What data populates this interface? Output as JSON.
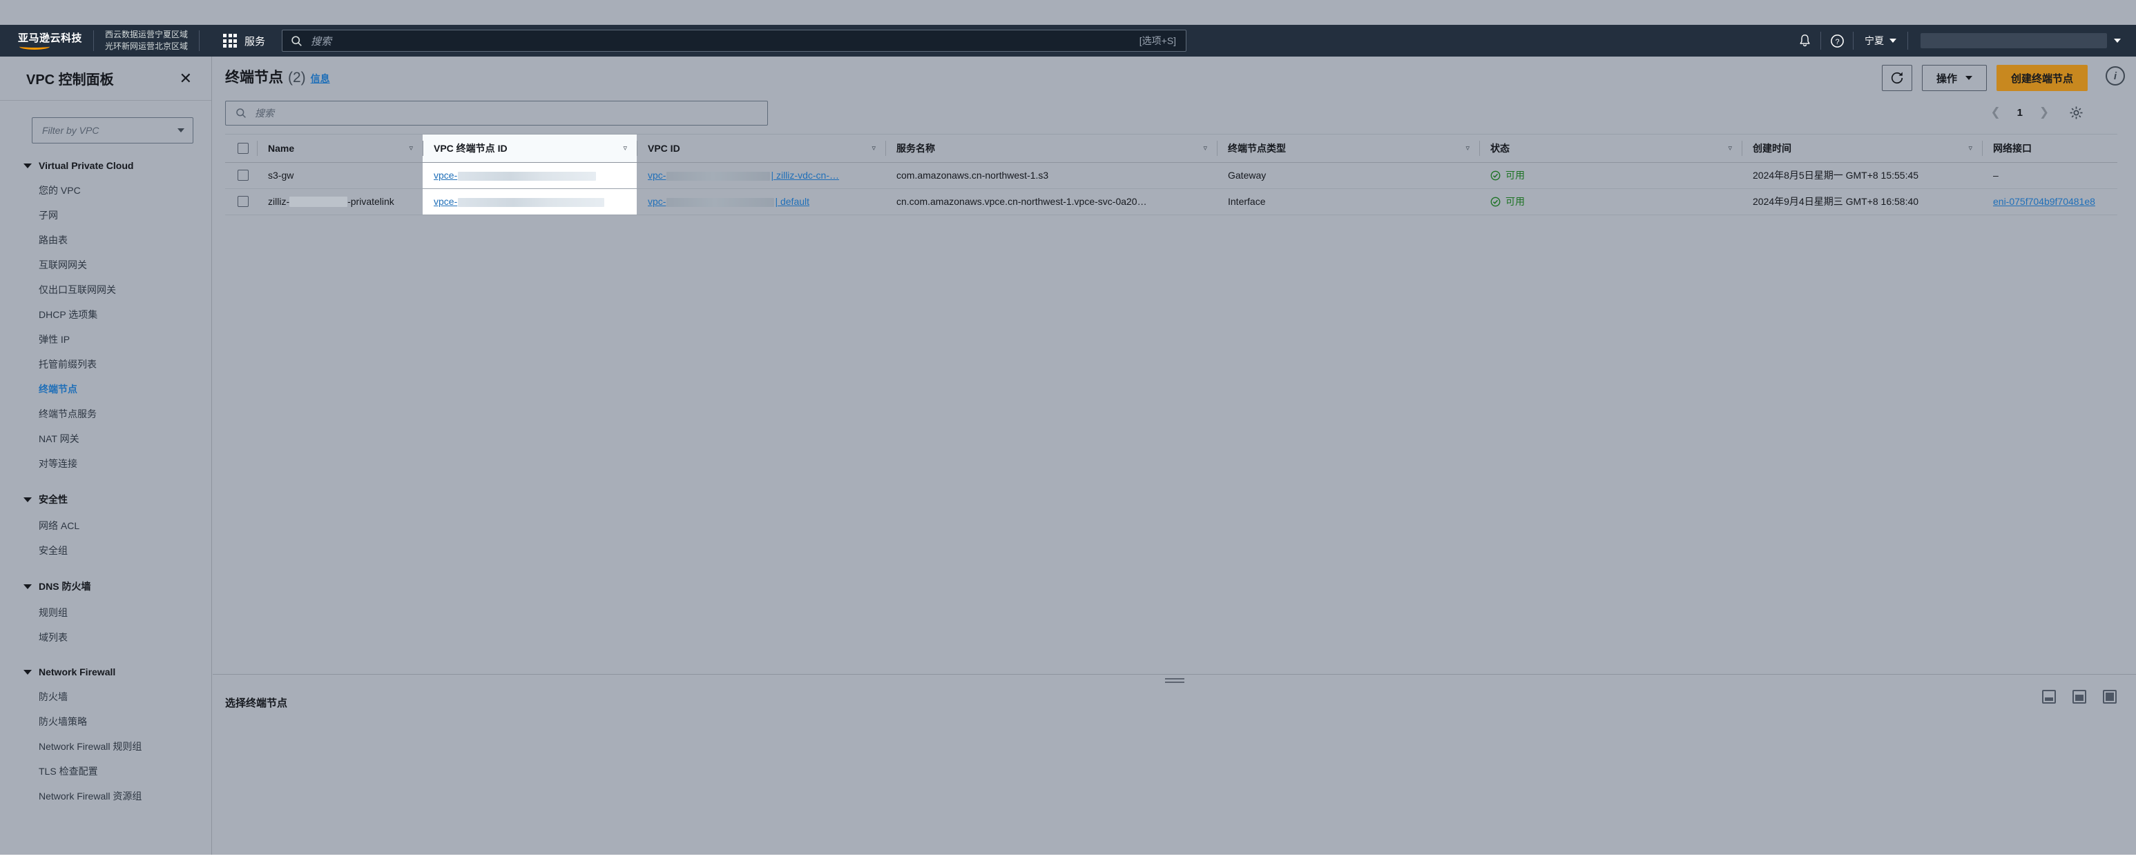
{
  "topnav": {
    "logo_line1": "亚马逊云科技",
    "operator_line1": "西云数据运营宁夏区域",
    "operator_line2": "光环新网运营北京区域",
    "services_label": "服务",
    "search_placeholder": "搜索",
    "search_shortcut": "[选项+S]",
    "region_label": "宁夏",
    "account_label": ""
  },
  "sidebar": {
    "title": "VPC 控制面板",
    "filter_placeholder": "Filter by VPC",
    "groups": [
      {
        "label": "Virtual Private Cloud",
        "items": [
          "您的 VPC",
          "子网",
          "路由表",
          "互联网网关",
          "仅出口互联网网关",
          "DHCP 选项集",
          "弹性 IP",
          "托管前缀列表",
          "终端节点",
          "终端节点服务",
          "NAT 网关",
          "对等连接"
        ],
        "active": "终端节点"
      },
      {
        "label": "安全性",
        "items": [
          "网络 ACL",
          "安全组"
        ],
        "active": ""
      },
      {
        "label": "DNS 防火墙",
        "items": [
          "规则组",
          "域列表"
        ],
        "active": ""
      },
      {
        "label": "Network Firewall",
        "items": [
          "防火墙",
          "防火墙策略",
          "Network Firewall 规则组",
          "TLS 检查配置",
          "Network Firewall 资源组"
        ],
        "active": ""
      }
    ]
  },
  "main": {
    "title": "终端节点",
    "count": "(2)",
    "info_link": "信息",
    "actions_label": "操作",
    "create_label": "创建终端节点",
    "search_placeholder": "搜索",
    "page_number": "1"
  },
  "table": {
    "columns": [
      "Name",
      "VPC 终端节点 ID",
      "VPC ID",
      "服务名称",
      "终端节点类型",
      "状态",
      "创建时间",
      "网络接口"
    ],
    "highlighted_column": "VPC 终端节点 ID",
    "rows": [
      {
        "name_prefix": "s3-gw",
        "name_suffix": "",
        "name_redacted": false,
        "endpoint_id_prefix": "vpce-",
        "vpc_id_prefix": "vpc-",
        "vpc_id_suffix": "| zilliz-vdc-cn-…",
        "service_name": "com.amazonaws.cn-northwest-1.s3",
        "endpoint_type": "Gateway",
        "status": "可用",
        "created": "2024年8月5日星期一 GMT+8 15:55:45",
        "network_interface": "–",
        "network_interface_is_link": false
      },
      {
        "name_prefix": "zilliz-",
        "name_suffix": "-privatelink",
        "name_redacted": true,
        "endpoint_id_prefix": "vpce-",
        "vpc_id_prefix": "vpc-",
        "vpc_id_suffix": "| default",
        "service_name": "cn.com.amazonaws.vpce.cn-northwest-1.vpce-svc-0a20…",
        "endpoint_type": "Interface",
        "status": "可用",
        "created": "2024年9月4日星期三 GMT+8 16:58:40",
        "network_interface": "eni-075f704b9f70481e8",
        "network_interface_is_link": true
      }
    ]
  },
  "split_panel": {
    "empty_title": "选择终端节点"
  },
  "colors": {
    "nav_bg": "#232f3e",
    "primary_button": "#c8881f",
    "link": "#1f6fb8",
    "status_ok": "#1d7324"
  }
}
